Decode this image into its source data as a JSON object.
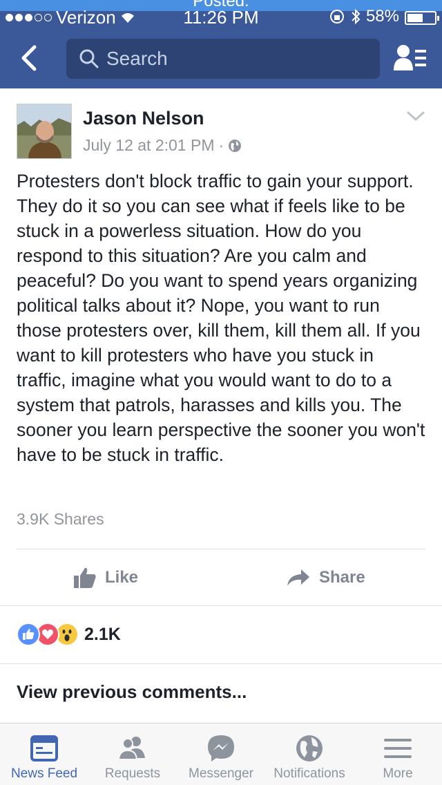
{
  "banner": {
    "text": "Posted."
  },
  "status_bar": {
    "carrier": "Verizon",
    "time": "11:26 PM",
    "battery_text": "58%",
    "battery_level": 0.58
  },
  "nav": {
    "search_placeholder": "Search",
    "icons": {
      "back": "chevron-left-icon",
      "search": "magnifier-icon",
      "friends": "friend-list-icon"
    }
  },
  "post": {
    "author": "Jason Nelson",
    "timestamp": "July 12 at 2:01 PM",
    "separator": "·",
    "privacy_icon": "globe-icon",
    "text": "Protesters don't block traffic to gain your support. They do it so you can see what if feels like to be stuck in a powerless situation. How do you respond to this situation? Are you calm and peaceful? Do you want to spend years organizing political talks about it? Nope, you want to run those protesters over, kill them, kill them all. If you want to kill protesters who have you stuck in traffic, imagine what you would want to do to a system that patrols, harasses and kills you. The sooner you learn perspective the sooner you won't have to be stuck in traffic.",
    "shares": "3.9K Shares",
    "actions": {
      "like": "Like",
      "share": "Share"
    },
    "reactions": {
      "icons": [
        "like-reaction-icon",
        "love-reaction-icon",
        "wow-reaction-icon"
      ],
      "count": "2.1K"
    },
    "view_previous": "View previous comments..."
  },
  "tabs": [
    {
      "label": "News Feed",
      "icon": "news-feed-icon",
      "active": true
    },
    {
      "label": "Requests",
      "icon": "friend-requests-icon",
      "active": false
    },
    {
      "label": "Messenger",
      "icon": "messenger-icon",
      "active": false
    },
    {
      "label": "Notifications",
      "icon": "globe-icon",
      "active": false
    },
    {
      "label": "More",
      "icon": "menu-icon",
      "active": false
    }
  ],
  "colors": {
    "brand": "#3b5998",
    "search_bg": "#2d4373",
    "active_tab": "#4267b2",
    "inactive_tab": "#8d949e"
  }
}
